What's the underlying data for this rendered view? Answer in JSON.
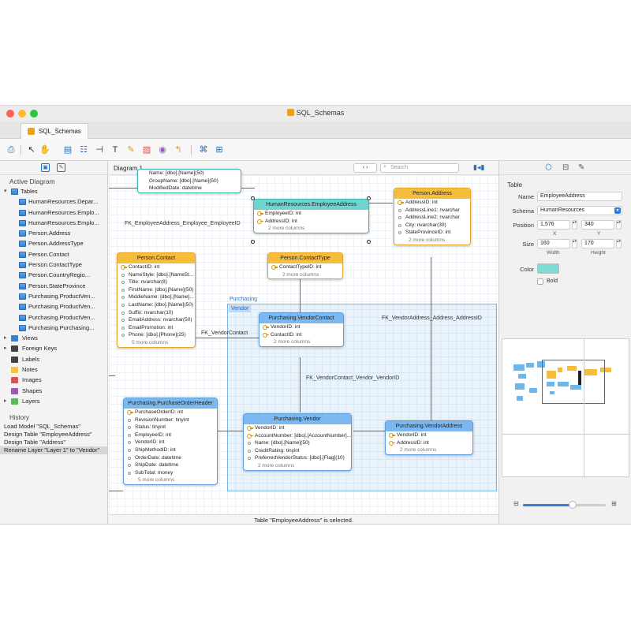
{
  "window": {
    "title": "SQL_Schemas",
    "tab_label": "SQL_Schemas",
    "traffic_colors": [
      "#fe5f57",
      "#febc2e",
      "#28c840"
    ]
  },
  "sidebar": {
    "section_title": "Active Diagram",
    "tables_label": "Tables",
    "tables": [
      "HumanResources.Depar...",
      "HumanResources.Emplo...",
      "HumanResources.Emplo...",
      "Person.Address",
      "Person.AddressType",
      "Person.Contact",
      "Person.ContactType",
      "Person.CountryRegio...",
      "Person.StateProvince",
      "Purchasing.ProductVen...",
      "Purchasing.ProductVen...",
      "Purchasing.ProductVen...",
      "Purchasing.Purchasing..."
    ],
    "other_items": [
      {
        "label": "Views",
        "icon": "views-icon",
        "color": "#3b82cc"
      },
      {
        "label": "Foreign Keys",
        "icon": "foreign-keys-icon",
        "color": "#444"
      },
      {
        "label": "Labels",
        "icon": "labels-icon",
        "color": "#444"
      },
      {
        "label": "Notes",
        "icon": "notes-icon",
        "color": "#f3c242"
      },
      {
        "label": "Images",
        "icon": "images-icon",
        "color": "#d9534f"
      },
      {
        "label": "Shapes",
        "icon": "shapes-icon",
        "color": "#9b59b6"
      },
      {
        "label": "Layers",
        "icon": "layers-icon",
        "color": "#5cb85c"
      }
    ],
    "history_title": "History",
    "history": [
      "Load Model \"SQL_Schemas\"",
      "Design Table \"EmployeeAddress\"",
      "Design Table \"Address\"",
      "Rename Layer \"Layer 1\" to \"Vendor\""
    ]
  },
  "canvas": {
    "diagram_name": "Diagram 1",
    "search_placeholder": "Search",
    "status": "Table \"EmployeeAddress\" is selected.",
    "group_label": "Purchasing",
    "layer_label": "Vendor",
    "labels": {
      "fk1": "FK_EmployeeAddress_Employee_EmployeeID",
      "fk2": "FK_VendorContact",
      "fk3": "FK_VendorAddress_Address_AddressID",
      "fk4": "FK_VendorContact_Vendor_VendorID"
    },
    "entities": {
      "top": {
        "title": "",
        "rows": [
          "Name: [dbo].[Name](50)",
          "GroupName: [dbo].[Name](50)",
          "ModifiedDate: datetime"
        ]
      },
      "employee_address": {
        "title": "HumanResources.EmployeeAddress",
        "rows": [
          "EmployeeID: int",
          "AddressID: int"
        ],
        "more": "2 more columns"
      },
      "person_address": {
        "title": "Person.Address",
        "rows": [
          "AddressID: int",
          "AddressLine1: nvarchar",
          "AddressLine2: nvarchar",
          "City: nvarchar(30)",
          "StateProvinceID: int"
        ],
        "more": "2 more columns"
      },
      "person_contact": {
        "title": "Person.Contact",
        "rows": [
          "ContactID: int",
          "NameStyle: [dbo].[NameSt...",
          "Title: nvarchar(8)",
          "FirstName: [dbo].[Name](50)",
          "MiddleName: [dbo].[Name]...",
          "LastName: [dbo].[Name](50)",
          "Suffix: nvarchar(10)",
          "EmailAddress: nvarchar(50)",
          "EmailPromotion: int",
          "Phone: [dbo].[Phone](25)"
        ],
        "more": "5 more columns"
      },
      "contact_type": {
        "title": "Person.ContactType",
        "rows": [
          "ContactTypeID: int"
        ],
        "more": "2 more columns"
      },
      "vendor_contact": {
        "title": "Purchasing.VendorContact",
        "rows": [
          "VendorID: int",
          "ContactID: int"
        ],
        "more": "2 more columns"
      },
      "po_header": {
        "title": "Purchasing.PurchaseOrderHeader",
        "rows": [
          "PurchaseOrderID: int",
          "RevisionNumber: tinyint",
          "Status: tinyint",
          "EmployeeID: int",
          "VendorID: int",
          "ShipMethodID: int",
          "OrderDate: datetime",
          "ShipDate: datetime",
          "SubTotal: money"
        ],
        "more": "5 more columns"
      },
      "vendor": {
        "title": "Purchasing.Vendor",
        "rows": [
          "VendorID: int",
          "AccountNumber: [dbo].[AccountNumber]...",
          "Name: [dbo].[Name](50)",
          "CreditRating: tinyint",
          "PreferredVendorStatus: [dbo].[Flag](10)"
        ],
        "more": "2 more columns"
      },
      "vendor_address": {
        "title": "Purchasing.VendorAddress",
        "rows": [
          "VendorID: int",
          "AddressID: int"
        ],
        "more": "2 more columns"
      }
    }
  },
  "inspector": {
    "section": "Table",
    "name_label": "Name",
    "name_value": "EmployeeAddress",
    "schema_label": "Schema",
    "schema_value": "HumanResources",
    "position_label": "Position",
    "x_value": "1,576",
    "y_value": "340",
    "x_caption": "X",
    "y_caption": "Y",
    "size_label": "Size",
    "w_value": "160",
    "h_value": "170",
    "w_caption": "Width",
    "h_caption": "Height",
    "color_label": "Color",
    "color_value": "#7fdbd6",
    "bold_label": "Bold",
    "zoom_level": 0.6
  }
}
